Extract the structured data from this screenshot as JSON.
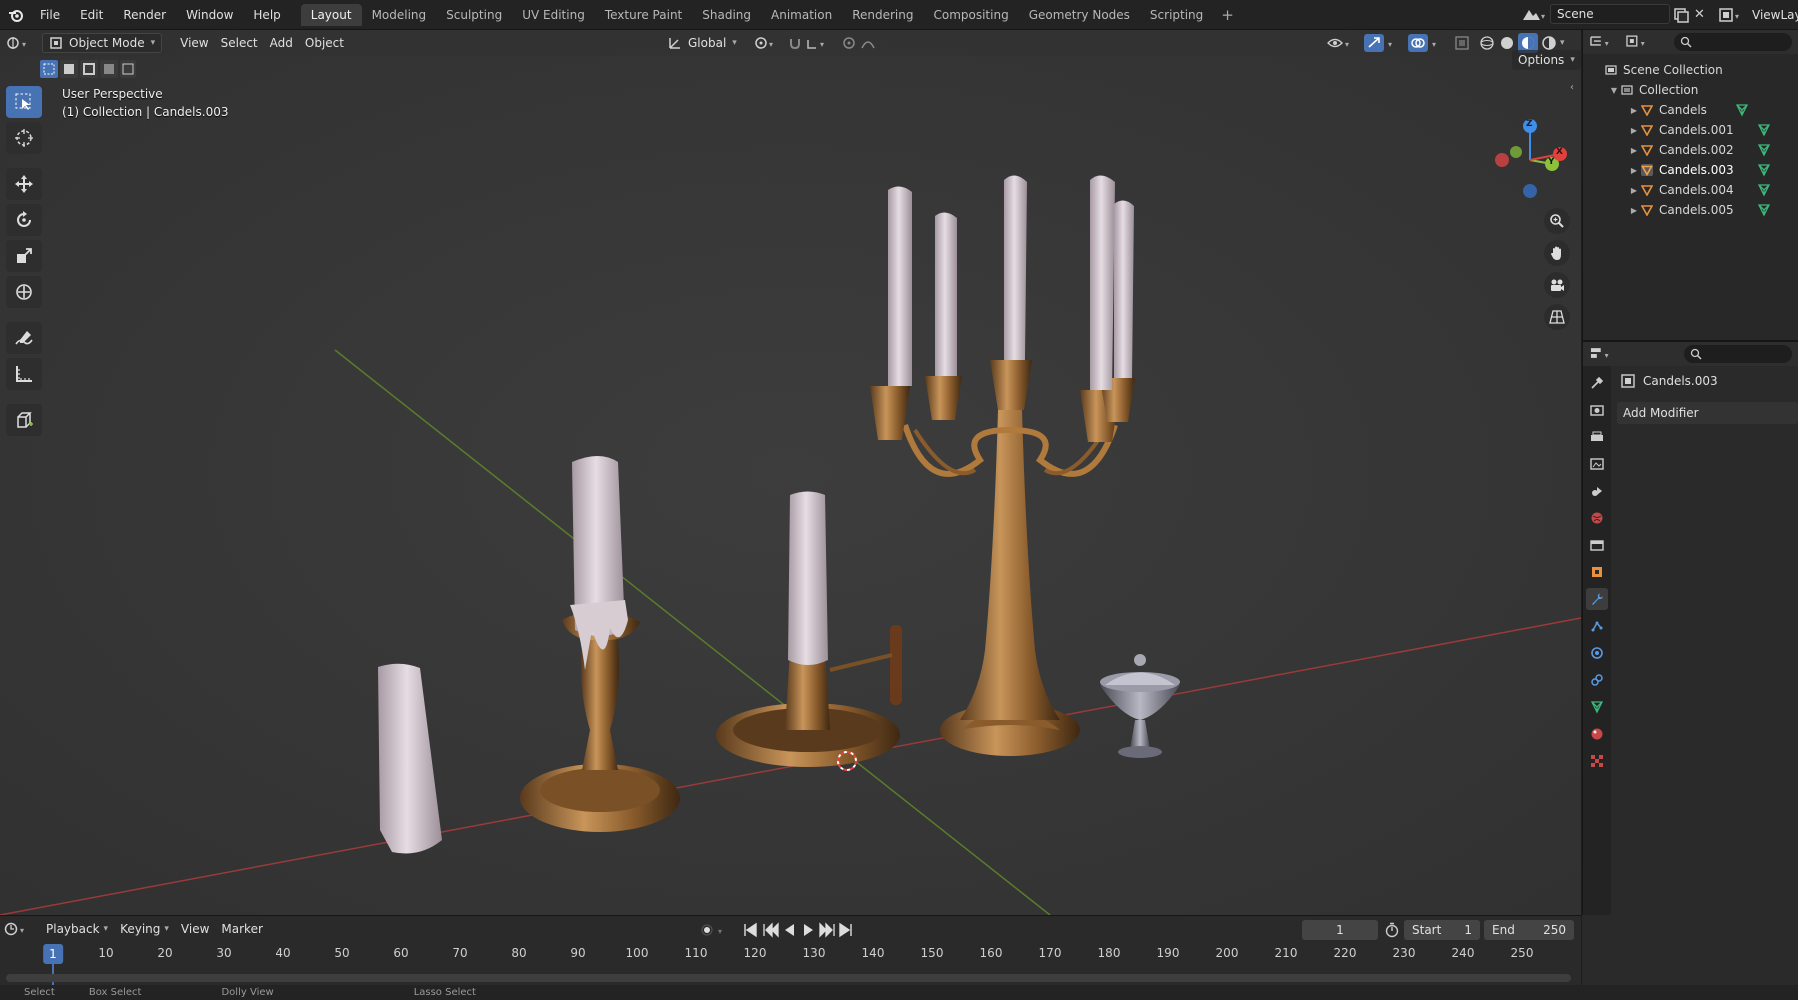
{
  "app": {
    "menus": [
      "File",
      "Edit",
      "Render",
      "Window",
      "Help"
    ],
    "workspaces": [
      "Layout",
      "Modeling",
      "Sculpting",
      "UV Editing",
      "Texture Paint",
      "Shading",
      "Animation",
      "Rendering",
      "Compositing",
      "Geometry Nodes",
      "Scripting"
    ],
    "active_workspace": "Layout",
    "add_workspace": "+",
    "scene_name": "Scene",
    "view_layer": "ViewLay"
  },
  "viewport": {
    "mode": "Object Mode",
    "menus": [
      "View",
      "Select",
      "Add",
      "Object"
    ],
    "transform_orientation": "Global",
    "options_label": "Options",
    "perspective_label": "User Perspective",
    "collection_label": "(1) Collection | Candels.003",
    "gizmo": {
      "x": "X",
      "y": "Y",
      "z": "Z"
    }
  },
  "outliner": {
    "scene_collection": "Scene Collection",
    "collection": "Collection",
    "objects": [
      "Candels",
      "Candels.001",
      "Candels.002",
      "Candels.003",
      "Candels.004",
      "Candels.005"
    ],
    "selected": "Candels.003"
  },
  "properties": {
    "object_name": "Candels.003",
    "add_modifier": "Add Modifier"
  },
  "timeline": {
    "menus": [
      "Playback",
      "Keying",
      "View",
      "Marker"
    ],
    "current_frame": "1",
    "start_label": "Start",
    "start": "1",
    "end_label": "End",
    "end": "250",
    "ticks": [
      "10",
      "20",
      "30",
      "40",
      "50",
      "60",
      "70",
      "80",
      "90",
      "100",
      "110",
      "120",
      "130",
      "140",
      "150",
      "160",
      "170",
      "180",
      "190",
      "200",
      "210",
      "220",
      "230",
      "240",
      "250"
    ],
    "playhead": "1"
  },
  "statusbar": {
    "items": [
      "Select",
      "Box Select",
      "Dolly View",
      "Lasso Select"
    ]
  },
  "colors": {
    "accent": "#4772b3",
    "x_axis": "#e0413d",
    "y_axis": "#8bc13b",
    "z_axis": "#3f8ee8",
    "object_icon": "#e8913f"
  }
}
